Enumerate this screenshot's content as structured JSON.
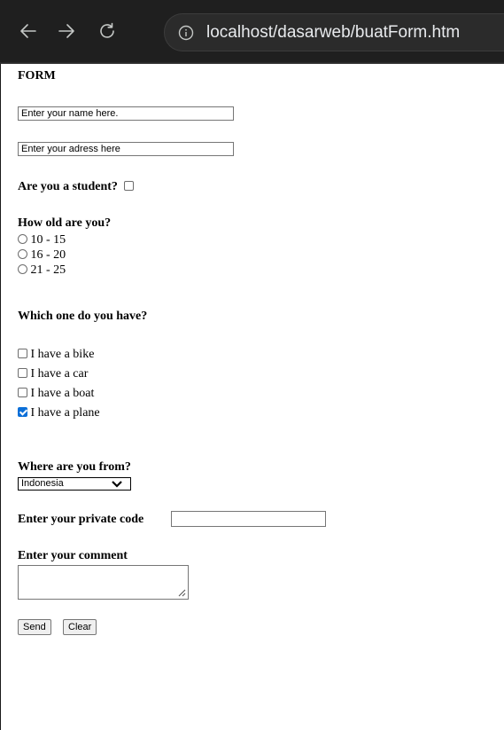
{
  "browser": {
    "url": "localhost/dasarweb/buatForm.htm",
    "icons": {
      "back": "back-arrow-icon",
      "forward": "forward-arrow-icon",
      "reload": "reload-icon",
      "info": "info-icon"
    }
  },
  "form": {
    "title": "FORM",
    "name_placeholder": "Enter your name here.",
    "address_placeholder": "Enter your adress here",
    "student_question": "Are you a student?",
    "student_checked": false,
    "age_question": "How old are you?",
    "age_options": [
      "10 - 15",
      "16 - 20",
      "21 - 25"
    ],
    "have_question": "Which one do you have?",
    "have_options": [
      {
        "label": "I have a bike",
        "checked": false
      },
      {
        "label": "I have a car",
        "checked": false
      },
      {
        "label": "I have a boat",
        "checked": false
      },
      {
        "label": "I have a plane",
        "checked": true
      }
    ],
    "from_question": "Where are you from?",
    "country_selected": "Indonesia",
    "private_code_label": "Enter your private code",
    "private_code_value": "",
    "comment_label": "Enter your comment",
    "comment_value": "",
    "send_label": "Send",
    "clear_label": "Clear"
  },
  "colors": {
    "chrome_bg": "#1f1f1f",
    "omnibox_bg": "#2b2b2b",
    "checked_blue": "#0b6fd8"
  }
}
